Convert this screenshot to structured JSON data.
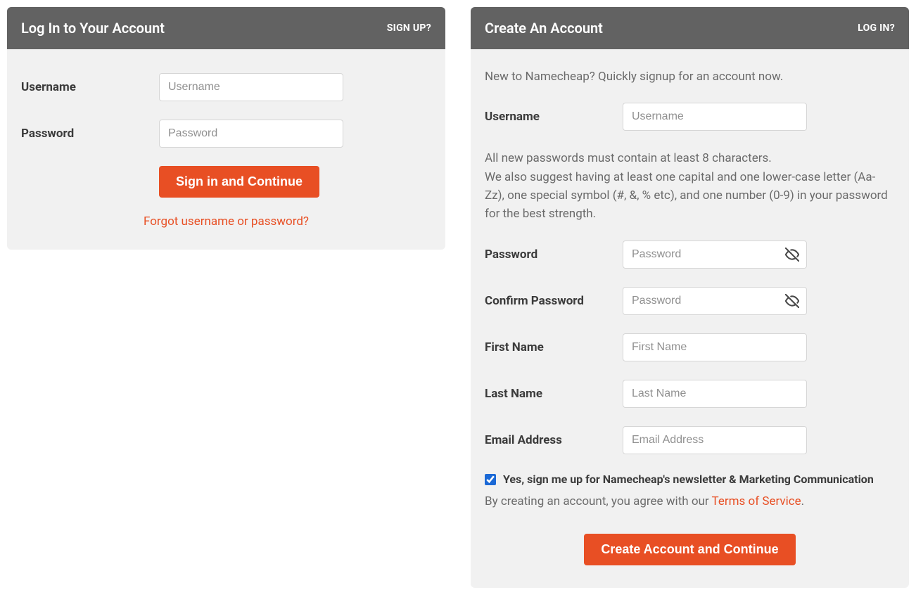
{
  "login": {
    "title": "Log In to Your Account",
    "alt_link": "SIGN UP?",
    "username_label": "Username",
    "username_placeholder": "Username",
    "password_label": "Password",
    "password_placeholder": "Password",
    "submit_label": "Sign in and Continue",
    "forgot_link": "Forgot username or password?"
  },
  "signup": {
    "title": "Create An Account",
    "alt_link": "LOG IN?",
    "intro": "New to Namecheap? Quickly signup for an account now.",
    "username_label": "Username",
    "username_placeholder": "Username",
    "pw_hint": "All new passwords must contain at least 8 characters.\nWe also suggest having at least one capital and one lower-case letter (Aa-Zz), one special symbol (#, &, % etc), and one number (0-9) in your password for the best strength.",
    "password_label": "Password",
    "password_placeholder": "Password",
    "confirm_label": "Confirm Password",
    "confirm_placeholder": "Password",
    "first_name_label": "First Name",
    "first_name_placeholder": "First Name",
    "last_name_label": "Last Name",
    "last_name_placeholder": "Last Name",
    "email_label": "Email Address",
    "email_placeholder": "Email Address",
    "newsletter_label": "Yes, sign me up for Namecheap's newsletter & Marketing Communication",
    "agree_prefix": "By creating an account, you agree with our ",
    "tos_link": "Terms of Service",
    "agree_suffix": ".",
    "submit_label": "Create Account and Continue"
  }
}
